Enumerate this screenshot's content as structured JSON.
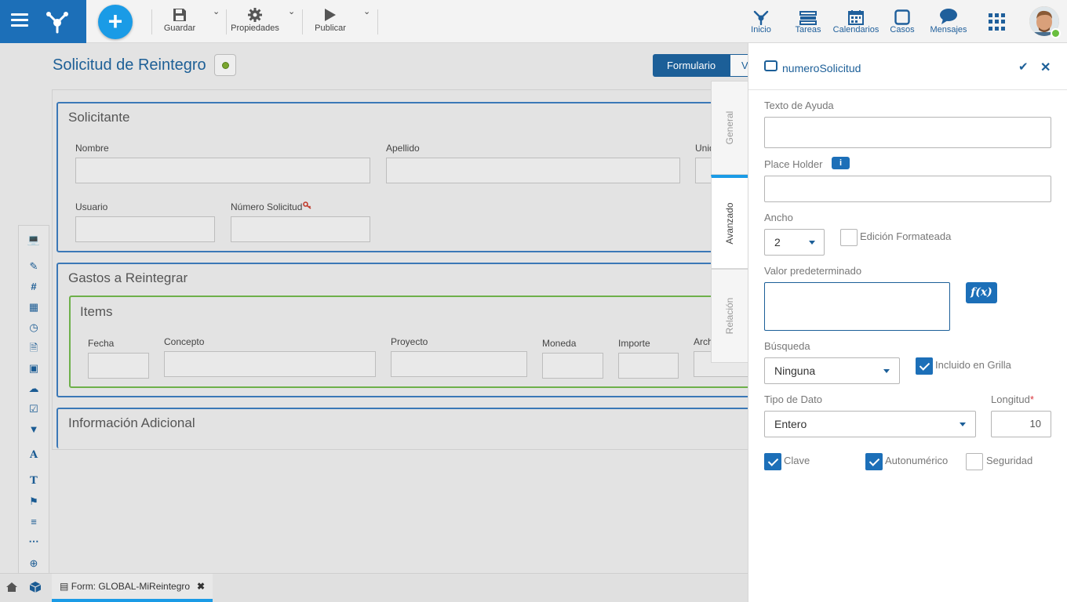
{
  "toolbar": {
    "save_label": "Guardar",
    "properties_label": "Propiedades",
    "publish_label": "Publicar"
  },
  "nav": {
    "home": "Inicio",
    "tasks": "Tareas",
    "calendars": "Calendarios",
    "cases": "Casos",
    "messages": "Mensajes"
  },
  "form": {
    "title": "Solicitud de Reintegro",
    "tabs": [
      "Formulario",
      "V"
    ],
    "sections": {
      "solicitante": {
        "title": "Solicitante",
        "fields": [
          "Nombre",
          "Apellido",
          "Unid",
          "Usuario",
          "Número Solicitud"
        ]
      },
      "gastos": {
        "title": "Gastos a Reintegrar",
        "items_title": "Items",
        "columns": [
          "Fecha",
          "Concepto",
          "Proyecto",
          "Moneda",
          "Importe",
          "Arch"
        ]
      },
      "adicional": {
        "title": "Información Adicional"
      }
    }
  },
  "bottom": {
    "doc_tab": "Form: GLOBAL-MiReintegro"
  },
  "vtabs": [
    "General",
    "Avanzado",
    "Relación"
  ],
  "panel": {
    "field_name": "numeroSolicitud",
    "help_text_label": "Texto de Ayuda",
    "help_text_value": "",
    "placeholder_label": "Place Holder",
    "placeholder_value": "",
    "width_label": "Ancho",
    "width_value": "2",
    "formatted_label": "Edición Formateada",
    "formatted_checked": false,
    "default_label": "Valor predeterminado",
    "default_value": "",
    "search_label": "Búsqueda",
    "search_value": "Ninguna",
    "in_grid_label": "Incluido en Grilla",
    "in_grid_checked": true,
    "datatype_label": "Tipo de Dato",
    "datatype_value": "Entero",
    "length_label": "Longitud",
    "length_required": "*",
    "length_value": "10",
    "key_label": "Clave",
    "key_checked": true,
    "autonum_label": "Autonumérico",
    "autonum_checked": true,
    "security_label": "Seguridad",
    "security_checked": false,
    "fx_label": "f(x)",
    "info_glyph": "i"
  },
  "colors": {
    "brand": "#1c6fb8",
    "accent": "#1a9be6",
    "status_dot": "#7aa52e",
    "items_border": "#6db04a"
  },
  "icons": [
    "menu-icon",
    "logo-icon",
    "save-icon",
    "gear-icon",
    "play-icon",
    "home-nav-icon",
    "tasks-icon",
    "calendar-icon",
    "cases-icon",
    "messages-icon",
    "apps-icon",
    "home-icon",
    "cube-icon"
  ]
}
